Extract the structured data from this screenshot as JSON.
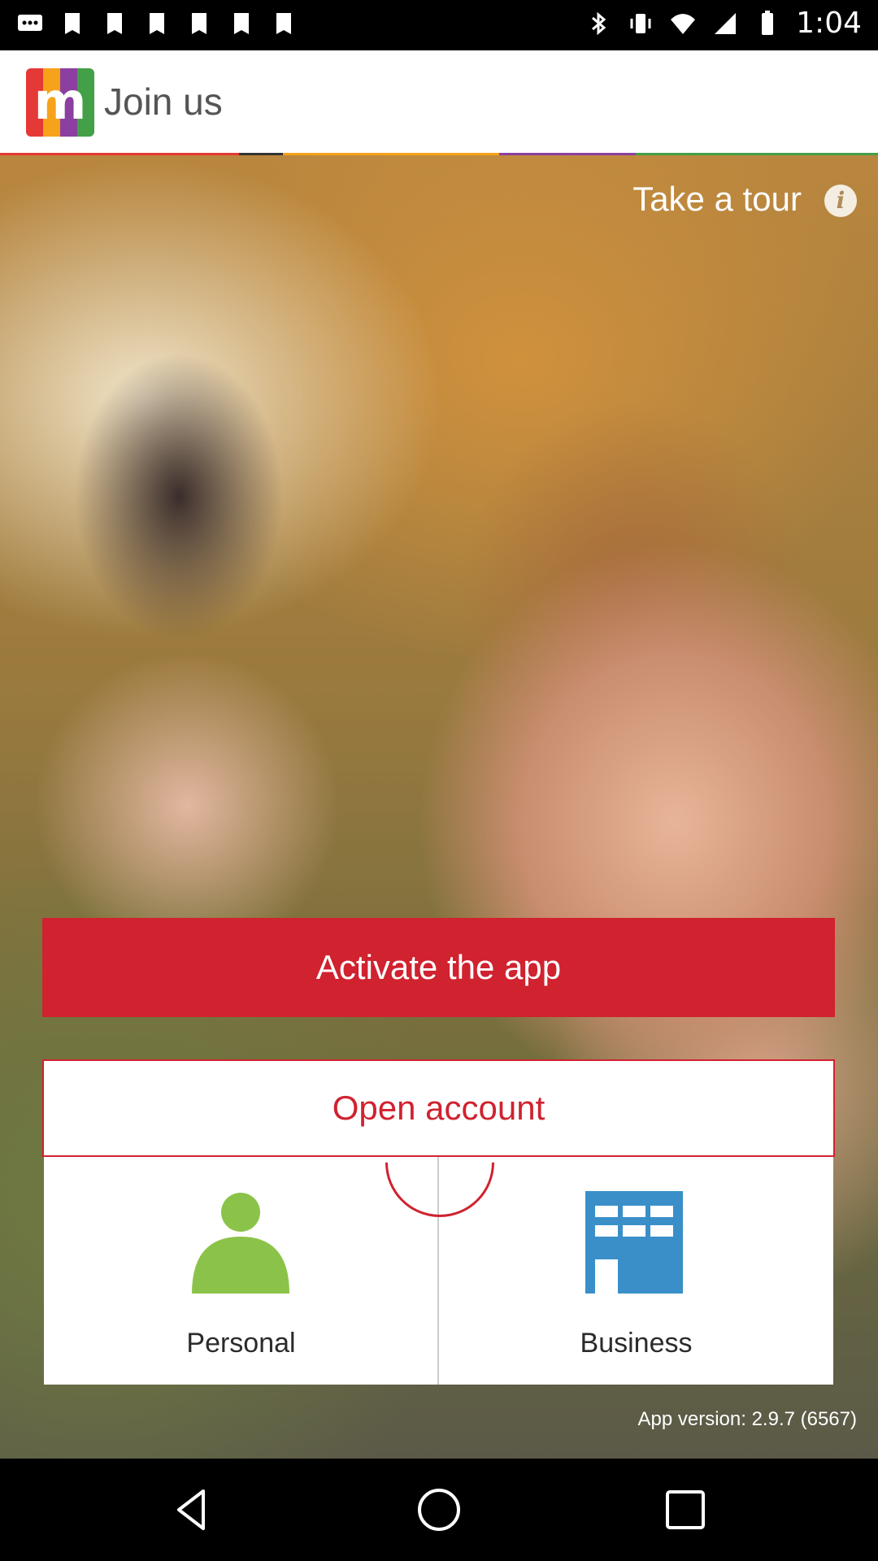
{
  "status_bar": {
    "time": "1:04",
    "icons": [
      "chat-icon",
      "image-icon",
      "image-icon",
      "image-icon",
      "image-icon",
      "image-icon",
      "image-icon",
      "bluetooth-icon",
      "vibrate-icon",
      "wifi-icon",
      "signal-icon",
      "battery-icon"
    ]
  },
  "header": {
    "app_title": "Join us",
    "logo_letter": "m",
    "accent_colors": [
      "#e53935",
      "#f7a21b",
      "#8b3fa0",
      "#43a047"
    ]
  },
  "hero": {
    "tour_label": "Take a tour",
    "info_glyph": "i"
  },
  "actions": {
    "activate_label": "Activate the app",
    "open_account_label": "Open account",
    "personal_label": "Personal",
    "business_label": "Business"
  },
  "footer": {
    "version_text": "App version: 2.9.7 (6567)"
  },
  "colors": {
    "primary_red": "#d0222f",
    "icon_green": "#8bc34a",
    "icon_blue": "#3a8fc9"
  }
}
